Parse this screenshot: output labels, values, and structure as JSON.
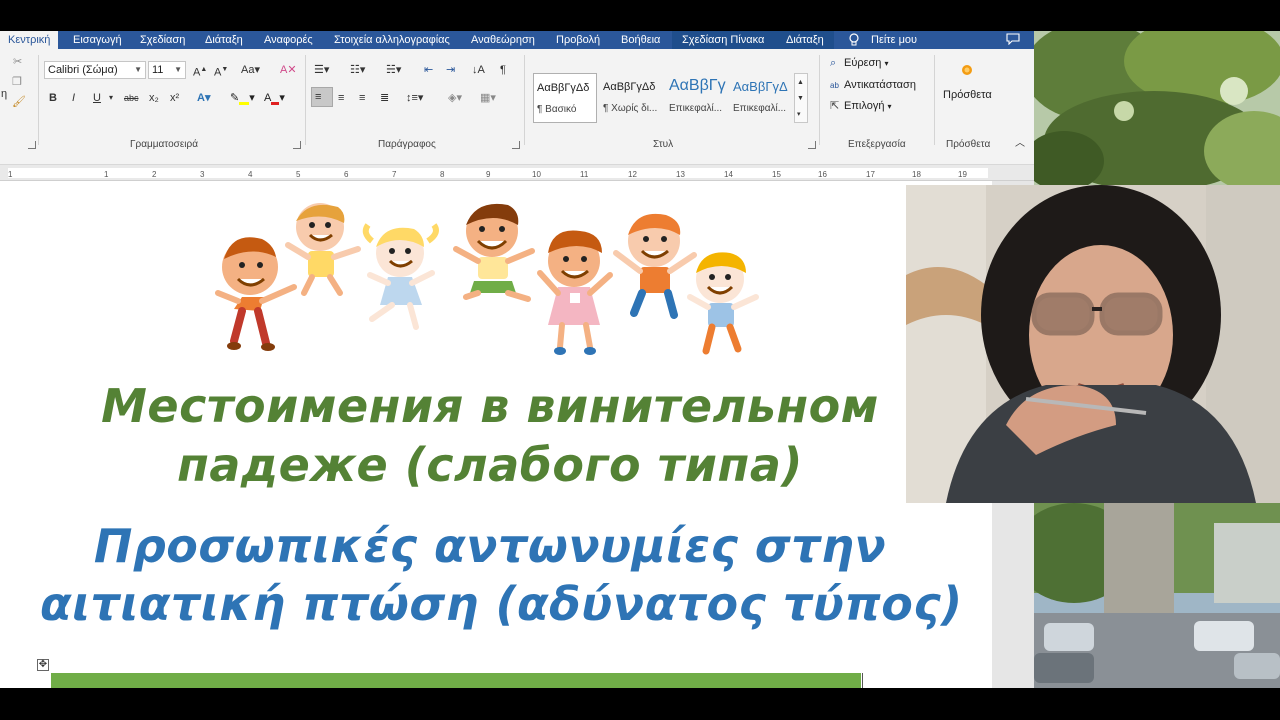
{
  "ribbon_tabs": [
    {
      "label": "Κεντρική",
      "active": true
    },
    {
      "label": "Εισαγωγή"
    },
    {
      "label": "Σχεδίαση"
    },
    {
      "label": "Διάταξη"
    },
    {
      "label": "Αναφορές"
    },
    {
      "label": "Στοιχεία αλληλογραφίας"
    },
    {
      "label": "Αναθεώρηση"
    },
    {
      "label": "Προβολή"
    },
    {
      "label": "Βοήθεια"
    },
    {
      "label": "Σχεδίαση Πίνακα"
    },
    {
      "label": "Διάταξη"
    }
  ],
  "tell_me": "Πείτε μου",
  "font": {
    "name": "Calibri (Σώμα)",
    "size": "11"
  },
  "format_buttons": [
    "B",
    "I",
    "U",
    "abc",
    "x₂",
    "x²"
  ],
  "groups": {
    "font": "Γραμματοσειρά",
    "paragraph": "Παράγραφος",
    "styles": "Στυλ",
    "editing": "Επεξεργασία",
    "addins": "Πρόσθετα"
  },
  "styles": [
    {
      "sample": "ΑαΒβΓγΔδ",
      "name": "¶ Βασικό"
    },
    {
      "sample": "ΑαΒβΓγΔδ",
      "name": "¶ Χωρίς δι..."
    },
    {
      "sample": "ΑαΒβΓγ",
      "name": "Επικεφαλί..."
    },
    {
      "sample": "ΑαΒβΓγΔ",
      "name": "Επικεφαλί..."
    }
  ],
  "editing": {
    "find": "Εύρεση",
    "replace": "Αντικατάσταση",
    "select": "Επιλογή"
  },
  "addins_button": "Πρόσθετα",
  "ruler_numbers": [
    "1",
    "1",
    "2",
    "3",
    "4",
    "5",
    "6",
    "7",
    "8",
    "9",
    "10",
    "11",
    "12",
    "13",
    "14",
    "15",
    "16",
    "17",
    "18",
    "19"
  ],
  "document": {
    "title_ru_line1": "Местоимения в винительном",
    "title_ru_line2": "падеже (слабого типа)",
    "title_gr_line1": "Προσωπικές αντωνυμίες στην",
    "title_gr_line2": "αιτιατική πτώση (αδύνατος τύπος)"
  },
  "colors": {
    "ribbon_blue": "#2b579a",
    "title_green": "#548235",
    "title_blue": "#2e74b5",
    "table_green": "#70ad47"
  }
}
